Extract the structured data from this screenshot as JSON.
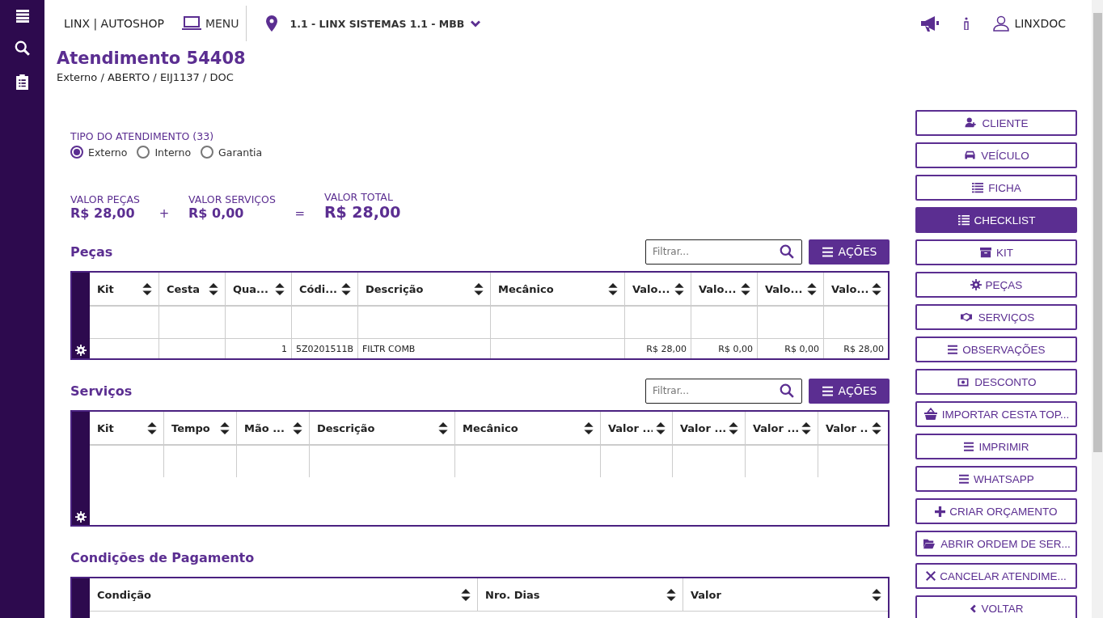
{
  "topbar": {
    "brand": "LINX | AUTOSHOP",
    "menu": "MENU",
    "location": "1.1 - LINX SISTEMAS 1.1 - MBB",
    "user": "LINXDOC"
  },
  "header": {
    "title": "Atendimento 54408",
    "subtitle": "Externo / ABERTO / EIJ1137 /  DOC"
  },
  "tipo": {
    "label": "TIPO DO ATENDIMENTO (33)",
    "options": [
      {
        "label": "Externo",
        "selected": true
      },
      {
        "label": "Interno",
        "selected": false
      },
      {
        "label": "Garantia",
        "selected": false
      }
    ]
  },
  "totals": [
    {
      "label": "VALOR PEÇAS",
      "value": "R$ 28,00",
      "op": "+"
    },
    {
      "label": "VALOR SERVIÇOS",
      "value": "R$ 0,00",
      "op": "="
    },
    {
      "label": "VALOR TOTAL",
      "value": "R$ 28,00"
    }
  ],
  "tables": [
    {
      "title": "Peças",
      "filter_placeholder": "Filtrar...",
      "actions": "AÇÕES",
      "columns": [
        "Kit",
        "Cesta",
        "Qua...",
        "Códi...",
        "Descrição",
        "Mecânico",
        "Valo...",
        "Valo...",
        "Valo...",
        "Valo..."
      ],
      "rows": [
        [
          "",
          "",
          "",
          "",
          "",
          "",
          "",
          "",
          "",
          ""
        ],
        [
          "",
          "",
          "1",
          "5Z0201511B",
          "FILTR COMB",
          "",
          "R$ 28,00",
          "R$ 0,00",
          "R$ 0,00",
          "R$ 28,00"
        ]
      ]
    },
    {
      "title": "Serviços",
      "filter_placeholder": "Filtrar...",
      "actions": "AÇÕES",
      "columns": [
        "Kit",
        "Tempo",
        "Mão ...",
        "Descrição",
        "Mecânico",
        "Valor ...",
        "Valor ...",
        "Valor ...",
        "Valor ..."
      ],
      "rows": [
        [
          "",
          "",
          "",
          "",
          "",
          "",
          "",
          "",
          ""
        ]
      ]
    },
    {
      "title": "Condições de Pagamento",
      "columns": [
        "Condição",
        "Nro. Dias",
        "Valor"
      ]
    }
  ],
  "buttons": [
    {
      "label": "CLIENTE",
      "selected": false
    },
    {
      "label": "VEÍCULO",
      "selected": false
    },
    {
      "label": "FICHA",
      "selected": false
    },
    {
      "label": "CHECKLIST",
      "selected": true
    },
    {
      "label": "KIT",
      "selected": false
    },
    {
      "label": "PEÇAS",
      "selected": false
    },
    {
      "label": "SERVIÇOS",
      "selected": false
    },
    {
      "label": "OBSERVAÇÕES",
      "selected": false
    },
    {
      "label": "DESCONTO",
      "selected": false
    },
    {
      "label": "IMPORTAR CESTA TOP...",
      "selected": false
    },
    {
      "label": "IMPRIMIR",
      "selected": false
    },
    {
      "label": "WHATSAPP",
      "selected": false
    },
    {
      "label": "CRIAR ORÇAMENTO",
      "selected": false
    },
    {
      "label": "ABRIR ORDEM DE SER...",
      "selected": false
    },
    {
      "label": "CANCELAR ATENDIME...",
      "selected": false
    },
    {
      "label": "VOLTAR",
      "selected": false
    }
  ]
}
